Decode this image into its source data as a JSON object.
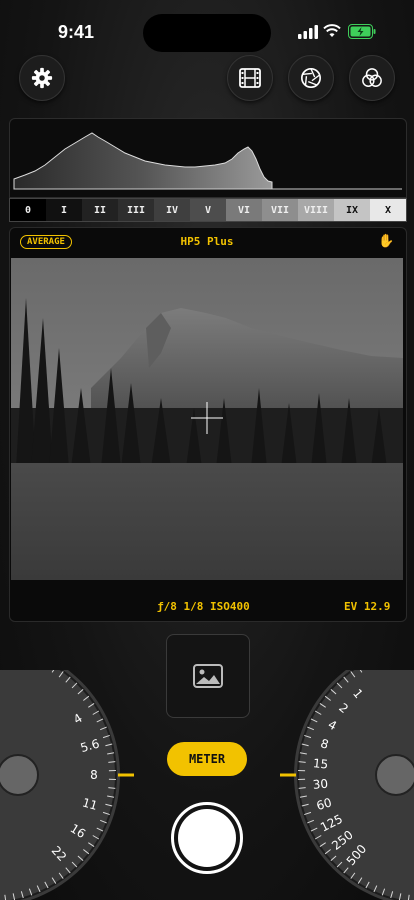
{
  "status": {
    "time": "9:41"
  },
  "toolbar": {
    "settings_icon": "gear-icon",
    "film_icon": "film-icon",
    "aperture_icon": "aperture-icon",
    "filters_icon": "filters-icon"
  },
  "histogram": {
    "zones": [
      "0",
      "I",
      "II",
      "III",
      "IV",
      "V",
      "VI",
      "VII",
      "VIII",
      "IX",
      "X"
    ],
    "zone_colors": [
      "#000000",
      "#111111",
      "#222222",
      "#2e2e2e",
      "#3f3f3f",
      "#4d4d4d",
      "#7a7a7a",
      "#8e8e8e",
      "#a8a8a8",
      "#c4c4c4",
      "#e8e8e8"
    ]
  },
  "viewfinder": {
    "metering_mode": "AVERAGE",
    "film": "HP5 Plus",
    "hand_icon": "hand-icon",
    "aperture": "ƒ/8",
    "shutter": "1/8",
    "iso": "ISO400",
    "ev": "EV 12.9"
  },
  "controls": {
    "meter_label": "METER",
    "gallery_icon": "image-icon"
  },
  "aperture_dial": {
    "values": [
      "4",
      "5.6",
      "8",
      "11",
      "16",
      "22"
    ],
    "selected": "8"
  },
  "shutter_dial": {
    "values": [
      "1",
      "2",
      "4",
      "8",
      "15",
      "30",
      "60",
      "125",
      "250",
      "500"
    ],
    "top_values": [
      "8",
      "4"
    ],
    "selected": "8"
  },
  "accent": "#f2c200"
}
